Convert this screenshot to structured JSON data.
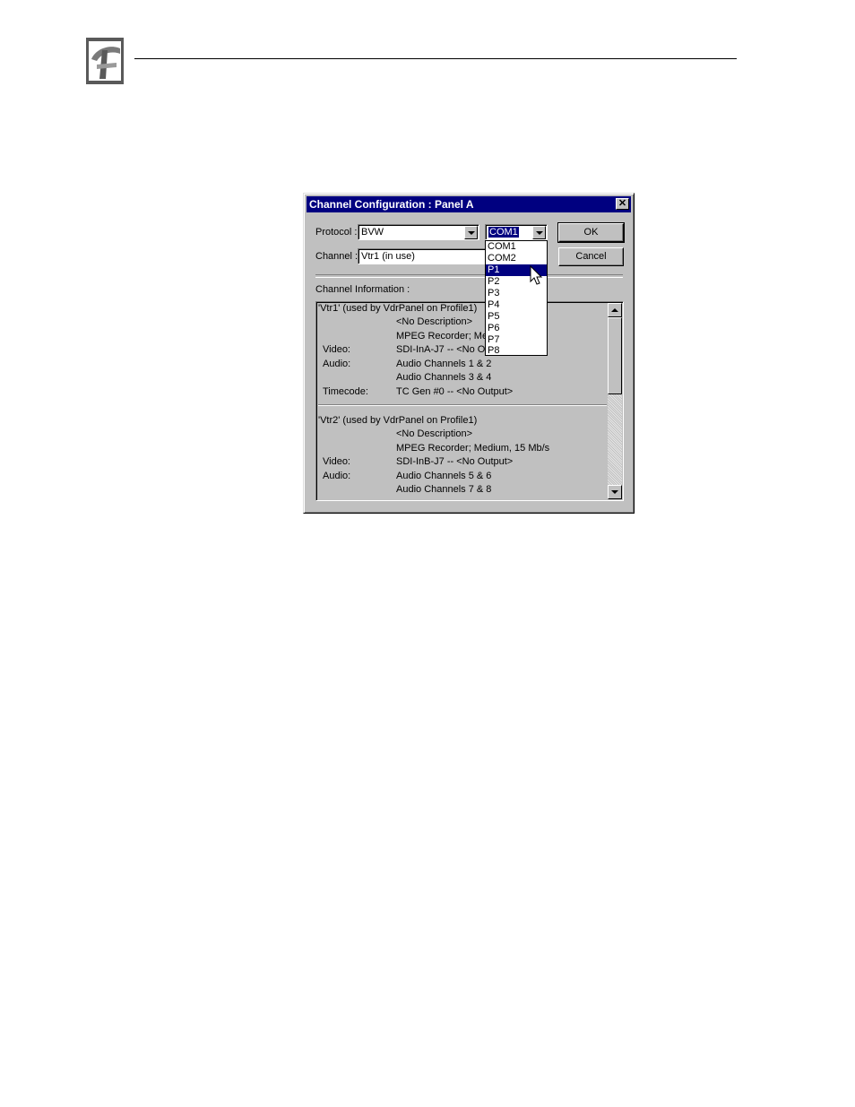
{
  "dialog": {
    "title": "Channel Configuration : Panel A",
    "close_glyph": "✕",
    "protocol_label": "Protocol :",
    "protocol_value": "BVW",
    "port_value": "COM1",
    "channel_label": "Channel :",
    "channel_value": "Vtr1 (in use)",
    "ok_label": "OK",
    "cancel_label": "Cancel",
    "info_label": "Channel Information :"
  },
  "port_options": [
    "COM1",
    "COM2",
    "P1",
    "P2",
    "P3",
    "P4",
    "P5",
    "P6",
    "P7",
    "P8"
  ],
  "port_highlighted": "P1",
  "channels": [
    {
      "header": "'Vtr1' (used by VdrPanel on Profile1)",
      "description": "<No Description>",
      "recorder": "MPEG Recorder; Me",
      "video_label": "Video:",
      "video": "SDI-InA-J7 -- <No Ou",
      "audio_label": "Audio:",
      "audio1": "Audio Channels 1 & 2",
      "audio2": "Audio Channels 3 & 4",
      "timecode_label": "Timecode:",
      "timecode": "TC Gen #0 -- <No Output>"
    },
    {
      "header": "'Vtr2' (used by VdrPanel on Profile1)",
      "description": "<No Description>",
      "recorder": "MPEG Recorder; Medium, 15 Mb/s",
      "video_label": "Video:",
      "video": "SDI-InB-J7 -- <No Output>",
      "audio_label": "Audio:",
      "audio1": "Audio Channels 5 & 6",
      "audio2": "Audio Channels 7 & 8",
      "timecode_label": "",
      "timecode": ""
    }
  ],
  "colors": {
    "titlebar": "#000080",
    "face": "#c0c0c0",
    "highlight": "#000080"
  }
}
